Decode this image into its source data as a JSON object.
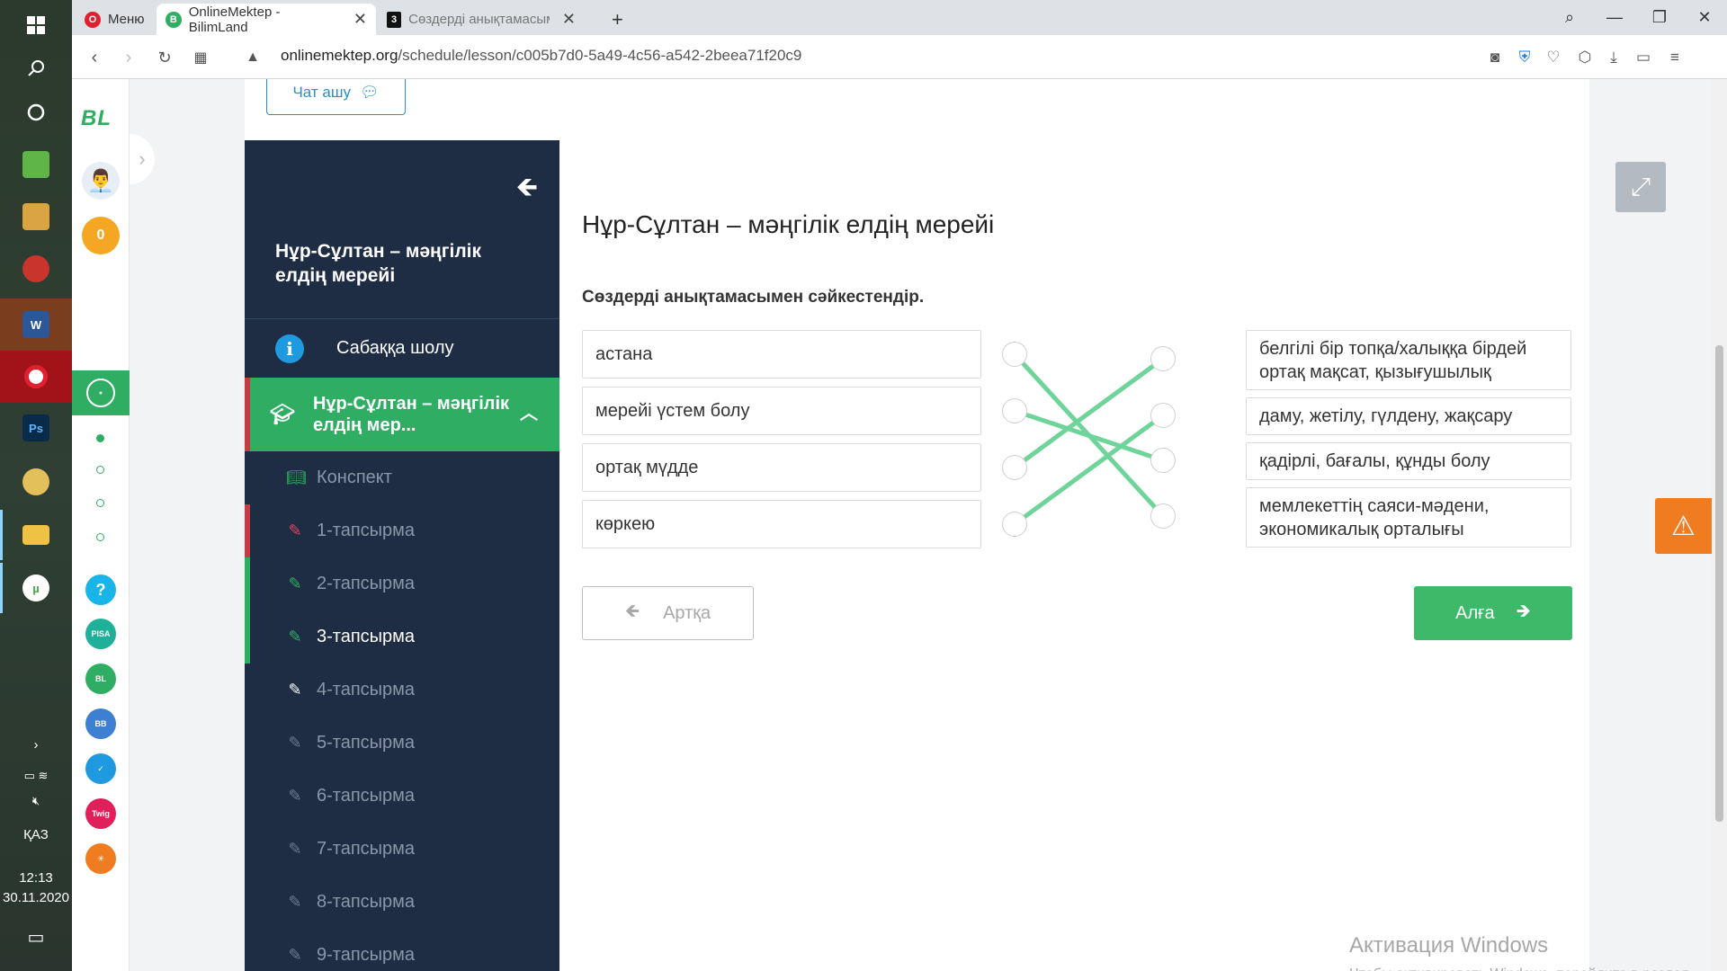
{
  "taskbar": {
    "lang": "ҚАЗ",
    "time": "12:13",
    "date": "30.11.2020"
  },
  "browser": {
    "menu_label": "Меню",
    "tabs": [
      {
        "label": "OnlineMektep - BilimLand"
      },
      {
        "label": "Сөздерді анықтамасымен"
      }
    ],
    "url_domain": "onlinemektep.org",
    "url_path": "/schedule/lesson/c005b7d0-5a49-4c56-a542-2beea71f20c9"
  },
  "rail": {
    "logo": "BL",
    "coins": "0"
  },
  "chat_button": "Чат ашу",
  "sidebar": {
    "lesson_title": "Нұр-Сұлтан – мәңгілік елдің мерейі",
    "overview": "Сабаққа шолу",
    "section": "Нұр-Сұлтан – мәңгілік елдің мер...",
    "items": [
      {
        "label": "Конспект",
        "state": "done"
      },
      {
        "label": "1-тапсырма",
        "state": "wrong"
      },
      {
        "label": "2-тапсырма",
        "state": "done"
      },
      {
        "label": "3-тапсырма",
        "state": "current"
      },
      {
        "label": "4-тапсырма",
        "state": "next"
      },
      {
        "label": "5-тапсырма",
        "state": "locked"
      },
      {
        "label": "6-тапсырма",
        "state": "locked"
      },
      {
        "label": "7-тапсырма",
        "state": "locked"
      },
      {
        "label": "8-тапсырма",
        "state": "locked"
      },
      {
        "label": "9-тапсырма",
        "state": "locked"
      }
    ]
  },
  "exercise": {
    "title": "Нұр-Сұлтан – мәңгілік елдің мерейі",
    "instruction": "Сөздерді анықтамасымен сәйкестендір.",
    "left": [
      "астана",
      "мерейі үстем болу",
      "ортақ мүдде",
      "көркею"
    ],
    "right": [
      "белгілі бір топқа/халыққа бірдей ортақ мақсат, қызығушылық",
      "даму, жетілу, гүлдену, жақсару",
      "қадірлі, бағалы, құнды болу",
      "мемлекеттің саяси-мәдени, экономикалық орталығы"
    ],
    "connections": [
      [
        0,
        3
      ],
      [
        1,
        2
      ],
      [
        2,
        0
      ],
      [
        3,
        1
      ]
    ],
    "line_color": "#6fd49a",
    "back_label": "Артқа",
    "next_label": "Алға"
  },
  "activation": {
    "title": "Активация Windows",
    "text": "Чтобы активировать Windows, перейдите в раздел \"Параметры\"."
  }
}
